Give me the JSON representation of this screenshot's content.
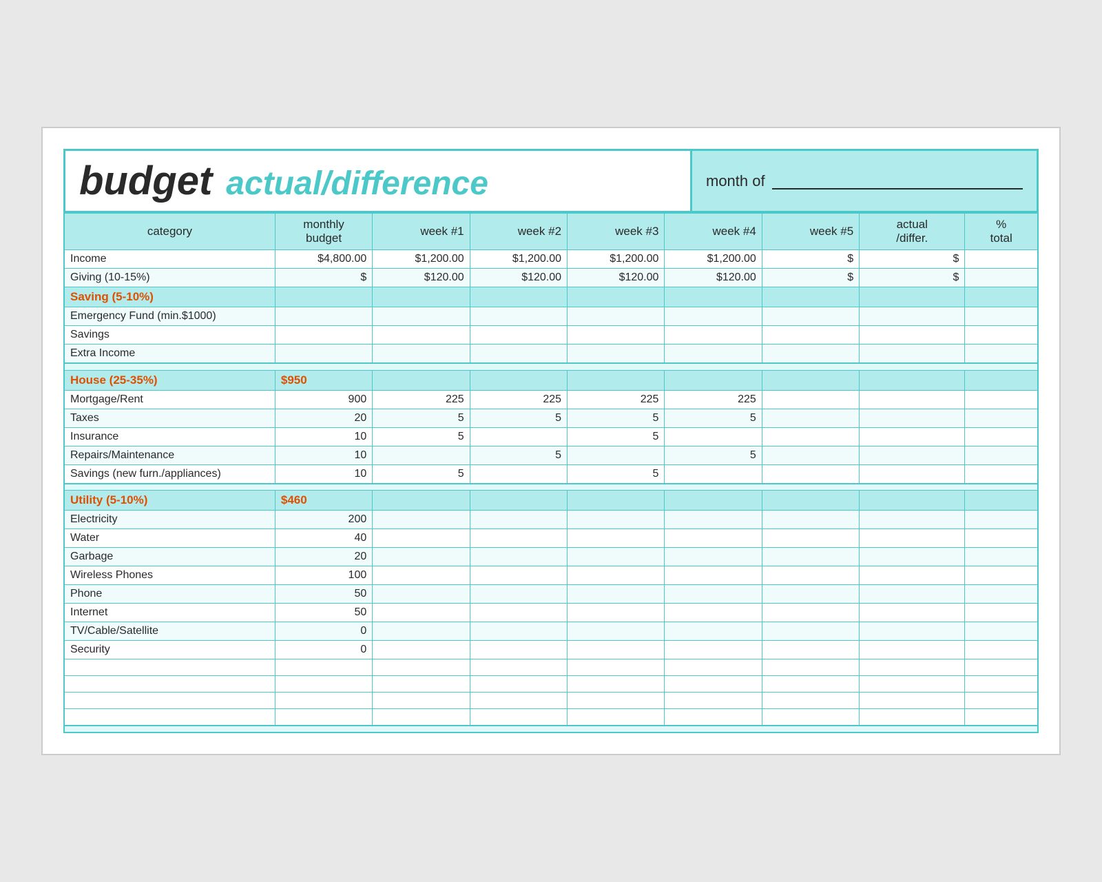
{
  "header": {
    "title_budget": "budget",
    "title_actual": "actual/difference",
    "month_label": "month of"
  },
  "table": {
    "columns": {
      "category": "category",
      "monthly_budget": "monthly\nbudget",
      "week1": "week #1",
      "week2": "week #2",
      "week3": "week #3",
      "week4": "week #4",
      "week5": "week #5",
      "actual": "actual\n/differ.",
      "pct_total": "%\ntotal"
    },
    "sections": [
      {
        "type": "data",
        "rows": [
          {
            "category": "Income",
            "monthly": "$4,800.00",
            "w1": "$1,200.00",
            "w2": "$1,200.00",
            "w3": "$1,200.00",
            "w4": "$1,200.00",
            "w5": "$",
            "actual": "$",
            "pct": ""
          },
          {
            "category": "Giving (10-15%)",
            "monthly": "$",
            "w1": "$120.00",
            "w2": "$120.00",
            "w3": "$120.00",
            "w4": "$120.00",
            "w5": "$",
            "actual": "$",
            "pct": ""
          }
        ]
      },
      {
        "type": "category-header",
        "label": "Saving (5-10%)",
        "monthly": "",
        "rows": [
          {
            "category": "Emergency Fund (min.$1000)",
            "monthly": "",
            "w1": "",
            "w2": "",
            "w3": "",
            "w4": "",
            "w5": "",
            "actual": "",
            "pct": ""
          },
          {
            "category": "Savings",
            "monthly": "",
            "w1": "",
            "w2": "",
            "w3": "",
            "w4": "",
            "w5": "",
            "actual": "",
            "pct": ""
          },
          {
            "category": "Extra Income",
            "monthly": "",
            "w1": "",
            "w2": "",
            "w3": "",
            "w4": "",
            "w5": "",
            "actual": "",
            "pct": ""
          }
        ]
      },
      {
        "type": "separator"
      },
      {
        "type": "category-header",
        "label": "House (25-35%)",
        "monthly": "$950",
        "rows": [
          {
            "category": "Mortgage/Rent",
            "monthly": "900",
            "w1": "225",
            "w2": "225",
            "w3": "225",
            "w4": "225",
            "w5": "",
            "actual": "",
            "pct": ""
          },
          {
            "category": "Taxes",
            "monthly": "20",
            "w1": "5",
            "w2": "5",
            "w3": "5",
            "w4": "5",
            "w5": "",
            "actual": "",
            "pct": ""
          },
          {
            "category": "Insurance",
            "monthly": "10",
            "w1": "5",
            "w2": "",
            "w3": "5",
            "w4": "",
            "w5": "",
            "actual": "",
            "pct": ""
          },
          {
            "category": "Repairs/Maintenance",
            "monthly": "10",
            "w1": "",
            "w2": "5",
            "w3": "",
            "w4": "5",
            "w5": "",
            "actual": "",
            "pct": ""
          },
          {
            "category": "Savings (new furn./appliances)",
            "monthly": "10",
            "w1": "5",
            "w2": "",
            "w3": "5",
            "w4": "",
            "w5": "",
            "actual": "",
            "pct": ""
          }
        ]
      },
      {
        "type": "separator"
      },
      {
        "type": "category-header",
        "label": "Utility (5-10%)",
        "monthly": "$460",
        "rows": [
          {
            "category": "Electricity",
            "monthly": "200",
            "w1": "",
            "w2": "",
            "w3": "",
            "w4": "",
            "w5": "",
            "actual": "",
            "pct": ""
          },
          {
            "category": "Water",
            "monthly": "40",
            "w1": "",
            "w2": "",
            "w3": "",
            "w4": "",
            "w5": "",
            "actual": "",
            "pct": ""
          },
          {
            "category": "Garbage",
            "monthly": "20",
            "w1": "",
            "w2": "",
            "w3": "",
            "w4": "",
            "w5": "",
            "actual": "",
            "pct": ""
          },
          {
            "category": "Wireless Phones",
            "monthly": "100",
            "w1": "",
            "w2": "",
            "w3": "",
            "w4": "",
            "w5": "",
            "actual": "",
            "pct": ""
          },
          {
            "category": "Phone",
            "monthly": "50",
            "w1": "",
            "w2": "",
            "w3": "",
            "w4": "",
            "w5": "",
            "actual": "",
            "pct": ""
          },
          {
            "category": "Internet",
            "monthly": "50",
            "w1": "",
            "w2": "",
            "w3": "",
            "w4": "",
            "w5": "",
            "actual": "",
            "pct": ""
          },
          {
            "category": "TV/Cable/Satellite",
            "monthly": "0",
            "w1": "",
            "w2": "",
            "w3": "",
            "w4": "",
            "w5": "",
            "actual": "",
            "pct": ""
          },
          {
            "category": "Security",
            "monthly": "0",
            "w1": "",
            "w2": "",
            "w3": "",
            "w4": "",
            "w5": "",
            "actual": "",
            "pct": ""
          }
        ]
      },
      {
        "type": "empty",
        "count": 4
      },
      {
        "type": "separator"
      }
    ]
  }
}
